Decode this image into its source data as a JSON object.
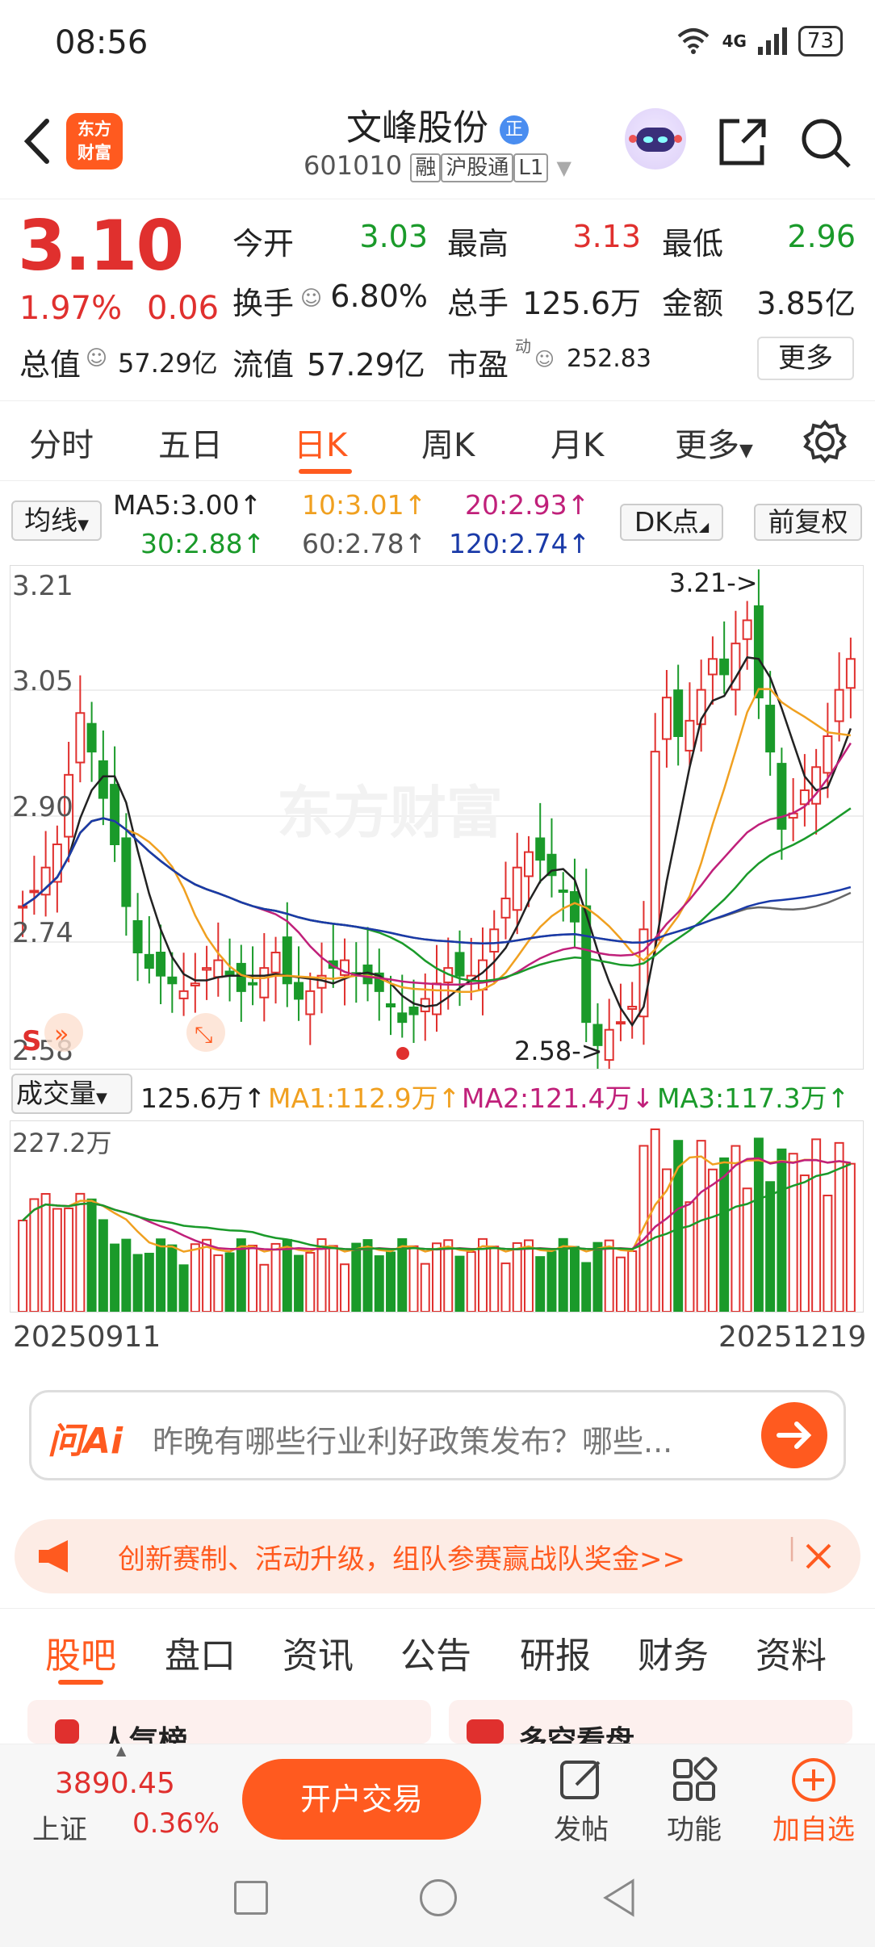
{
  "status": {
    "time": "08:56",
    "network": "4G",
    "battery": "73"
  },
  "header": {
    "title": "文峰股份",
    "title_badge": "正",
    "code": "601010",
    "badge_margin": "融",
    "badge_connect": "沪股通",
    "badge_level": "L1",
    "logo_line1": "东方",
    "logo_line2": "财富"
  },
  "quote": {
    "price": "3.10",
    "change_pct": "1.97%",
    "change": "0.06",
    "open_label": "今开",
    "open": "3.03",
    "high_label": "最高",
    "high": "3.13",
    "low_label": "最低",
    "low": "2.96",
    "turnover_label": "换手",
    "turnover": "6.80%",
    "volume_label": "总手",
    "volume": "125.6万",
    "amount_label": "金额",
    "amount": "3.85亿",
    "mktcap_label": "总值",
    "mktcap": "57.29亿",
    "float_label": "流值",
    "float": "57.29亿",
    "pe_label": "市盈",
    "pe_sup": "动",
    "pe": "252.83",
    "more": "更多"
  },
  "tabs": [
    "分时",
    "五日",
    "日K",
    "周K",
    "月K",
    "更多"
  ],
  "ma": {
    "selector": "均线",
    "ma5": "MA5:3.00↑",
    "ma10": "10:3.01↑",
    "ma20": "20:2.93↑",
    "ma30": "30:2.88↑",
    "ma60": "60:2.78↑",
    "ma120": "120:2.74↑",
    "dk": "DK点",
    "fq": "前复权"
  },
  "kline": {
    "y_labels": [
      "3.21",
      "3.05",
      "2.90",
      "2.74",
      "2.58"
    ],
    "high_note": "3.21->",
    "low_note": "2.58->",
    "watermark": "东方财富",
    "s_mark": "S"
  },
  "volume": {
    "selector": "成交量",
    "vol": "125.6万↑",
    "ma1": "MA1:112.9万↑",
    "ma2": "MA2:121.4万↓",
    "ma3": "MA3:117.3万↑",
    "top_label": "227.2万"
  },
  "dates": {
    "start": "20250911",
    "end": "20251219"
  },
  "ai": {
    "logo": "问Ai",
    "placeholder": "昨晚有哪些行业利好政策发布？哪些..."
  },
  "banner": {
    "text": "创新赛制、活动升级，组队参赛赢战队奖金>>"
  },
  "bottom_tabs": [
    "股吧",
    "盘口",
    "资讯",
    "公告",
    "研报",
    "财务",
    "资料"
  ],
  "peek": {
    "left": "人气榜",
    "right": "多空看盘"
  },
  "bottom": {
    "index_value": "3890.45",
    "index_name": "上证",
    "index_pct": "0.36%",
    "trade": "开户交易",
    "post": "发帖",
    "func": "功能",
    "add": "加自选"
  },
  "colors": {
    "accent": "#ff5a1f",
    "up": "#e0302e",
    "down": "#1a9a2a"
  }
}
